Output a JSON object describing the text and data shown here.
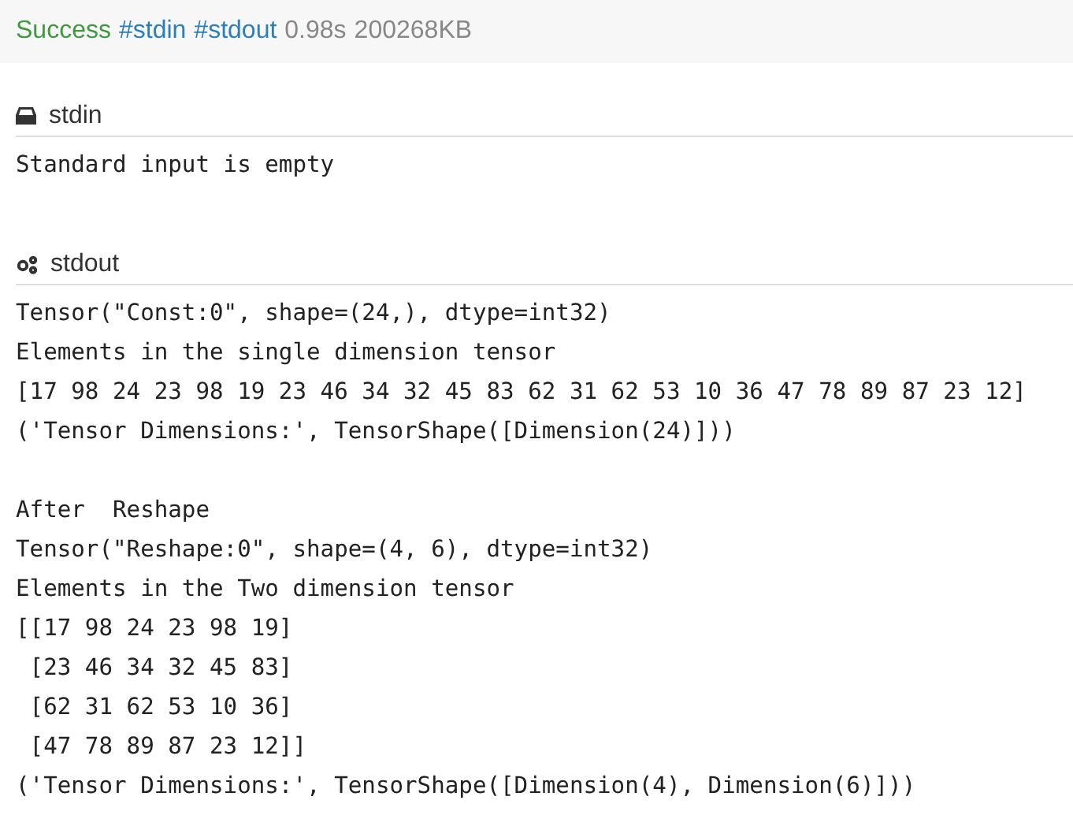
{
  "status": {
    "result": "Success",
    "tags": [
      "#stdin",
      "#stdout"
    ],
    "time": "0.98s",
    "memory": "200268KB"
  },
  "sections": [
    {
      "kind": "stdin",
      "title": "stdin",
      "blocks": [
        [
          "Standard input is empty"
        ]
      ]
    },
    {
      "kind": "stdout",
      "title": "stdout",
      "blocks": [
        [
          "Tensor(\"Const:0\", shape=(24,), dtype=int32)",
          "Elements in the single dimension tensor",
          "[17 98 24 23 98 19 23 46 34 32 45 83 62 31 62 53 10 36 47 78 89 87 23 12]",
          "('Tensor Dimensions:', TensorShape([Dimension(24)]))"
        ],
        [
          "After  Reshape",
          "Tensor(\"Reshape:0\", shape=(4, 6), dtype=int32)",
          "Elements in the Two dimension tensor",
          "[[17 98 24 23 98 19]",
          " [23 46 34 32 45 83]",
          " [62 31 62 53 10 36]",
          " [47 78 89 87 23 12]]",
          "('Tensor Dimensions:', TensorShape([Dimension(4), Dimension(6)]))"
        ]
      ]
    }
  ]
}
